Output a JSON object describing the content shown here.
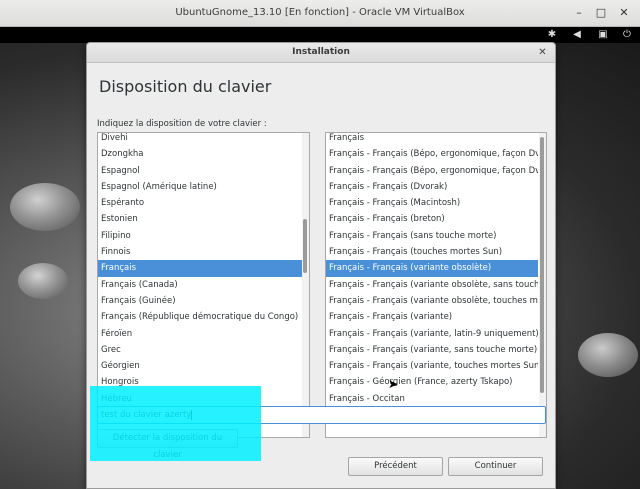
{
  "vbox_window": {
    "title": "UbuntuGnome_13.10 [En fonction] - Oracle VM VirtualBox",
    "controls": {
      "minimize": "–",
      "maximize": "□",
      "close": "✕"
    }
  },
  "gnome_panel": {
    "icons": [
      "accessibility-icon",
      "volume-icon",
      "network-icon",
      "power-icon"
    ]
  },
  "dialog": {
    "window_title": "Installation",
    "close_glyph": "✕",
    "page_title": "Disposition du clavier",
    "prompt": "Indiquez la disposition de votre clavier :",
    "layouts": [
      "Divehi",
      "Dzongkha",
      "Espagnol",
      "Espagnol (Amérique latine)",
      "Espéranto",
      "Estonien",
      "Filipino",
      "Finnois",
      "Français",
      "Français (Canada)",
      "Français (Guinée)",
      "Français (République démocratique du Congo)",
      "Féroïen",
      "Grec",
      "Géorgien",
      "Hongrois",
      "Hébreu"
    ],
    "selected_layout_index": 8,
    "variants": [
      "Français",
      "Français - Français (Bépo, ergonomique, façon Dvorak)",
      "Français - Français (Bépo, ergonomique, façon Dvorak)",
      "Français - Français (Dvorak)",
      "Français - Français (Macintosh)",
      "Français - Français (breton)",
      "Français - Français (sans touche morte)",
      "Français - Français (touches mortes Sun)",
      "Français - Français (variante obsolète)",
      "Français - Français (variante obsolète, sans touche morte)",
      "Français - Français (variante obsolète, touches mortes Sun)",
      "Français - Français (variante)",
      "Français - Français (variante, latin-9 uniquement)",
      "Français - Français (variante, sans touche morte)",
      "Français - Français (variante, touches mortes Sun)",
      "Français - Géorgien (France, azerty Tskapo)",
      "Français - Occitan"
    ],
    "selected_variant_index": 8,
    "test_input_value": "test du clavier azerty",
    "detect_button": "Détecter la disposition du clavier",
    "back_button": "Précédent",
    "continue_button": "Continuer",
    "colors": {
      "selection": "#4a90d9",
      "annotation_highlight": "#00f0ff"
    }
  }
}
